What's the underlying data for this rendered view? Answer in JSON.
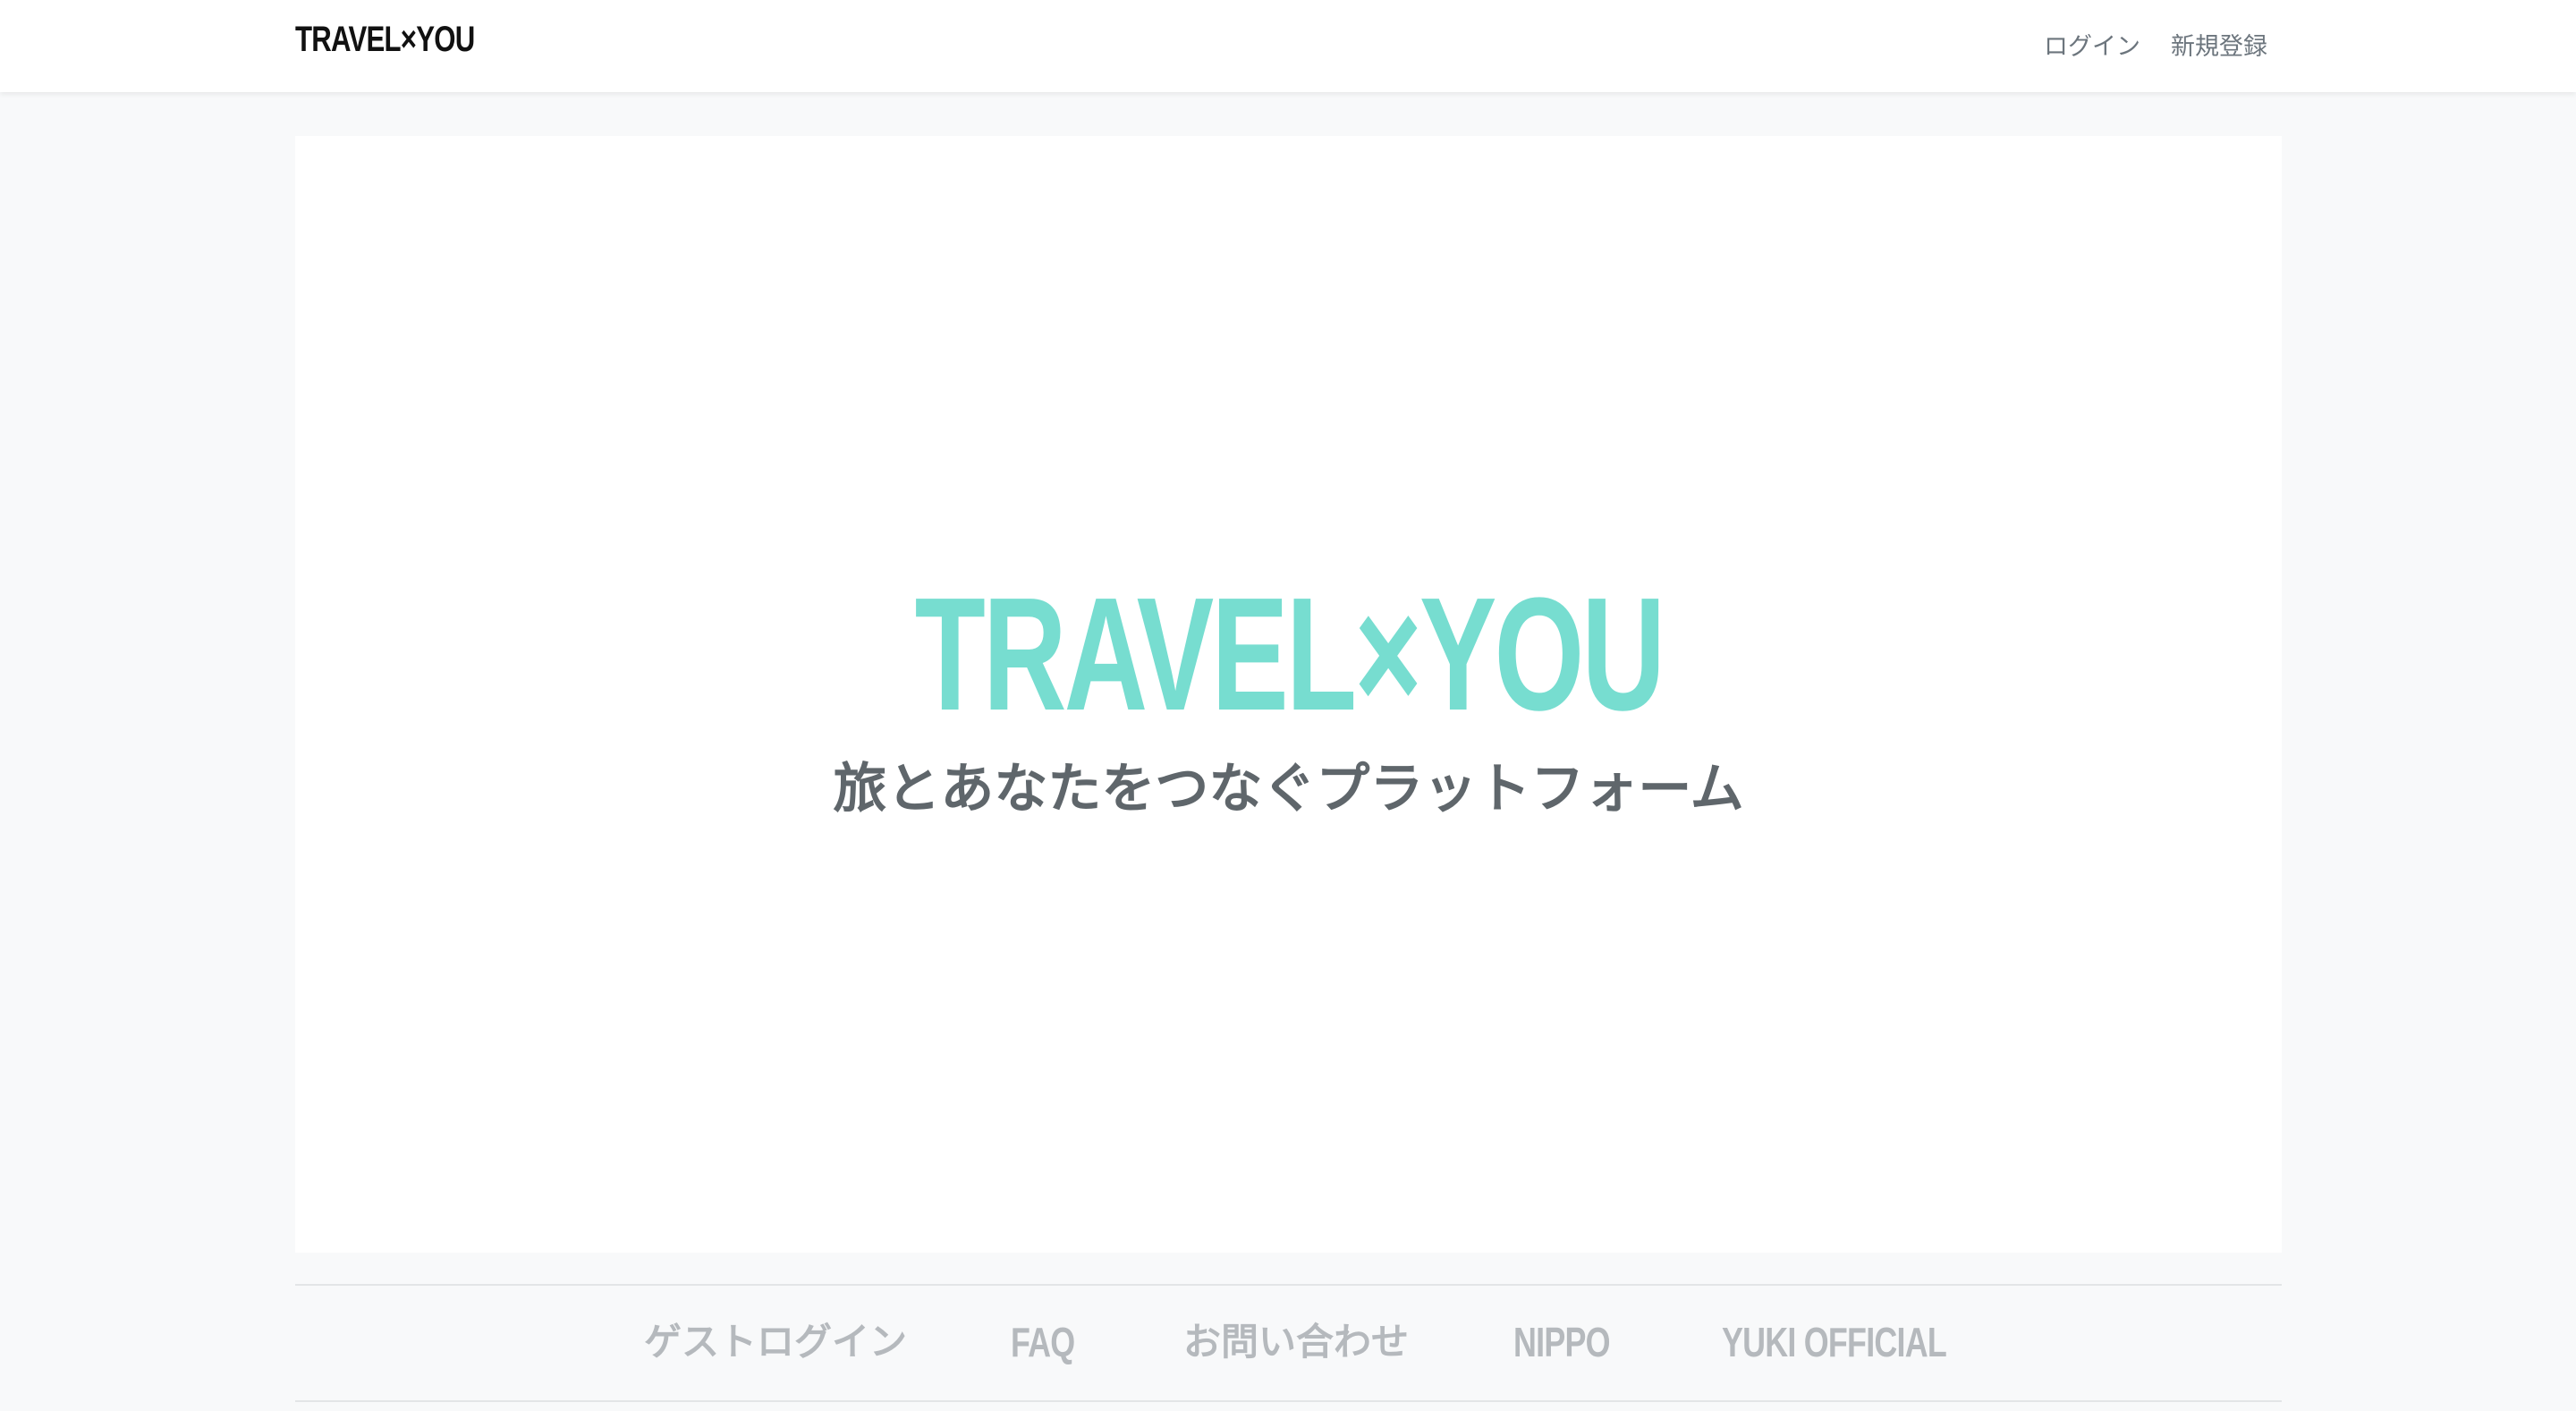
{
  "navbar": {
    "brand": "TRAVEL×YOU",
    "links": [
      {
        "label": "ログイン"
      },
      {
        "label": "新規登録"
      }
    ]
  },
  "hero": {
    "title": "TRAVEL×YOU",
    "subtitle": "旅とあなたをつなぐプラットフォーム"
  },
  "footer": {
    "links": [
      {
        "label": "ゲストログイン"
      },
      {
        "label": "FAQ"
      },
      {
        "label": "お問い合わせ"
      },
      {
        "label": "NIPPO"
      },
      {
        "label": "YUKI OFFICIAL"
      }
    ]
  },
  "colors": {
    "accent": "#77ddd0",
    "subtitle": "#5f666b",
    "footer_link": "#b5b9bd",
    "page_bg": "#f8f9fa"
  }
}
